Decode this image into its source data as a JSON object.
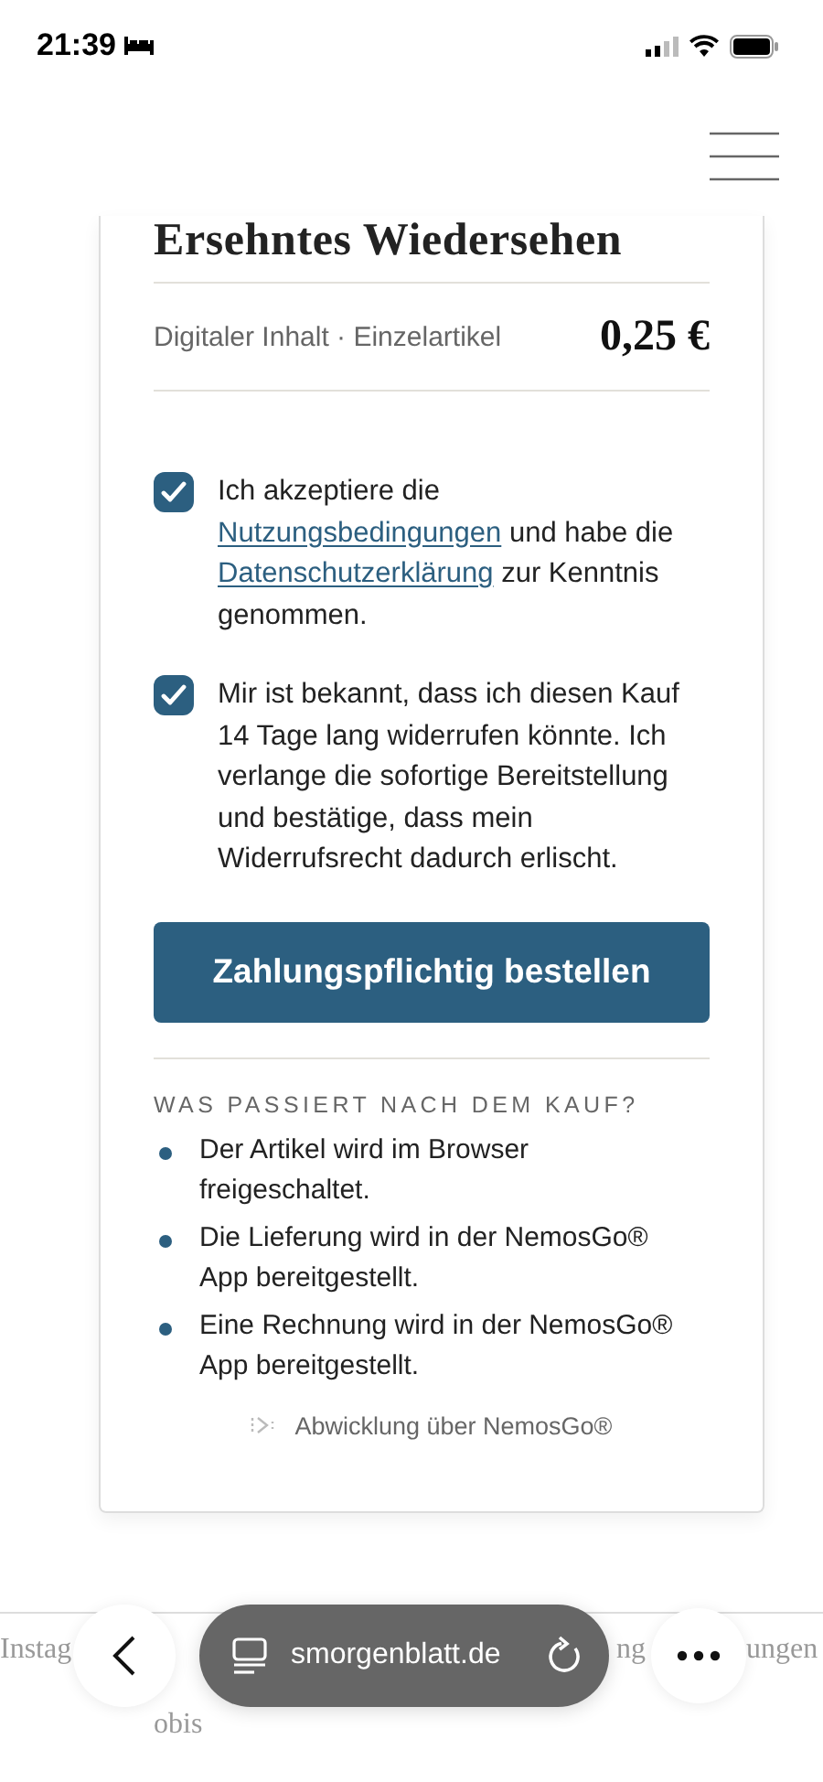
{
  "status_bar": {
    "time": "21:39"
  },
  "product": {
    "title": "Ersehntes Wiedersehen",
    "description": "Digitaler Inhalt · Einzelartikel",
    "price": "0,25 €"
  },
  "consents": [
    {
      "checked": true,
      "parts": [
        {
          "kind": "text",
          "text": "Ich akzeptiere die "
        },
        {
          "kind": "link",
          "text": "Nutzungsbedingungen"
        },
        {
          "kind": "text",
          "text": " und habe die "
        },
        {
          "kind": "link",
          "text": "Datenschutzerklärung"
        },
        {
          "kind": "text",
          "text": " zur Kenntnis genommen."
        }
      ]
    },
    {
      "checked": true,
      "parts": [
        {
          "kind": "text",
          "text": "Mir ist bekannt, dass ich diesen Kauf 14 Tage lang widerrufen könnte. Ich verlange die sofortige Bereitstellung und bestätige, dass mein Widerrufsrecht dadurch erlischt."
        }
      ]
    }
  ],
  "order_button": "Zahlungspflichtig bestellen",
  "after_purchase": {
    "heading": "WAS PASSIERT NACH DEM KAUF?",
    "items": [
      "Der Artikel wird im Browser freigeschaltet.",
      "Die Lieferung wird in der NemosGo® App bereitgestellt.",
      "Eine Rechnung wird in der NemosGo® App bereitgestellt."
    ],
    "note": "Abwicklung über NemosGo®"
  },
  "footer": {
    "links": [
      "Instag",
      "ng",
      "ungen"
    ],
    "second_line": "obis"
  },
  "browser_bar": {
    "url": "smorgenblatt.de"
  }
}
